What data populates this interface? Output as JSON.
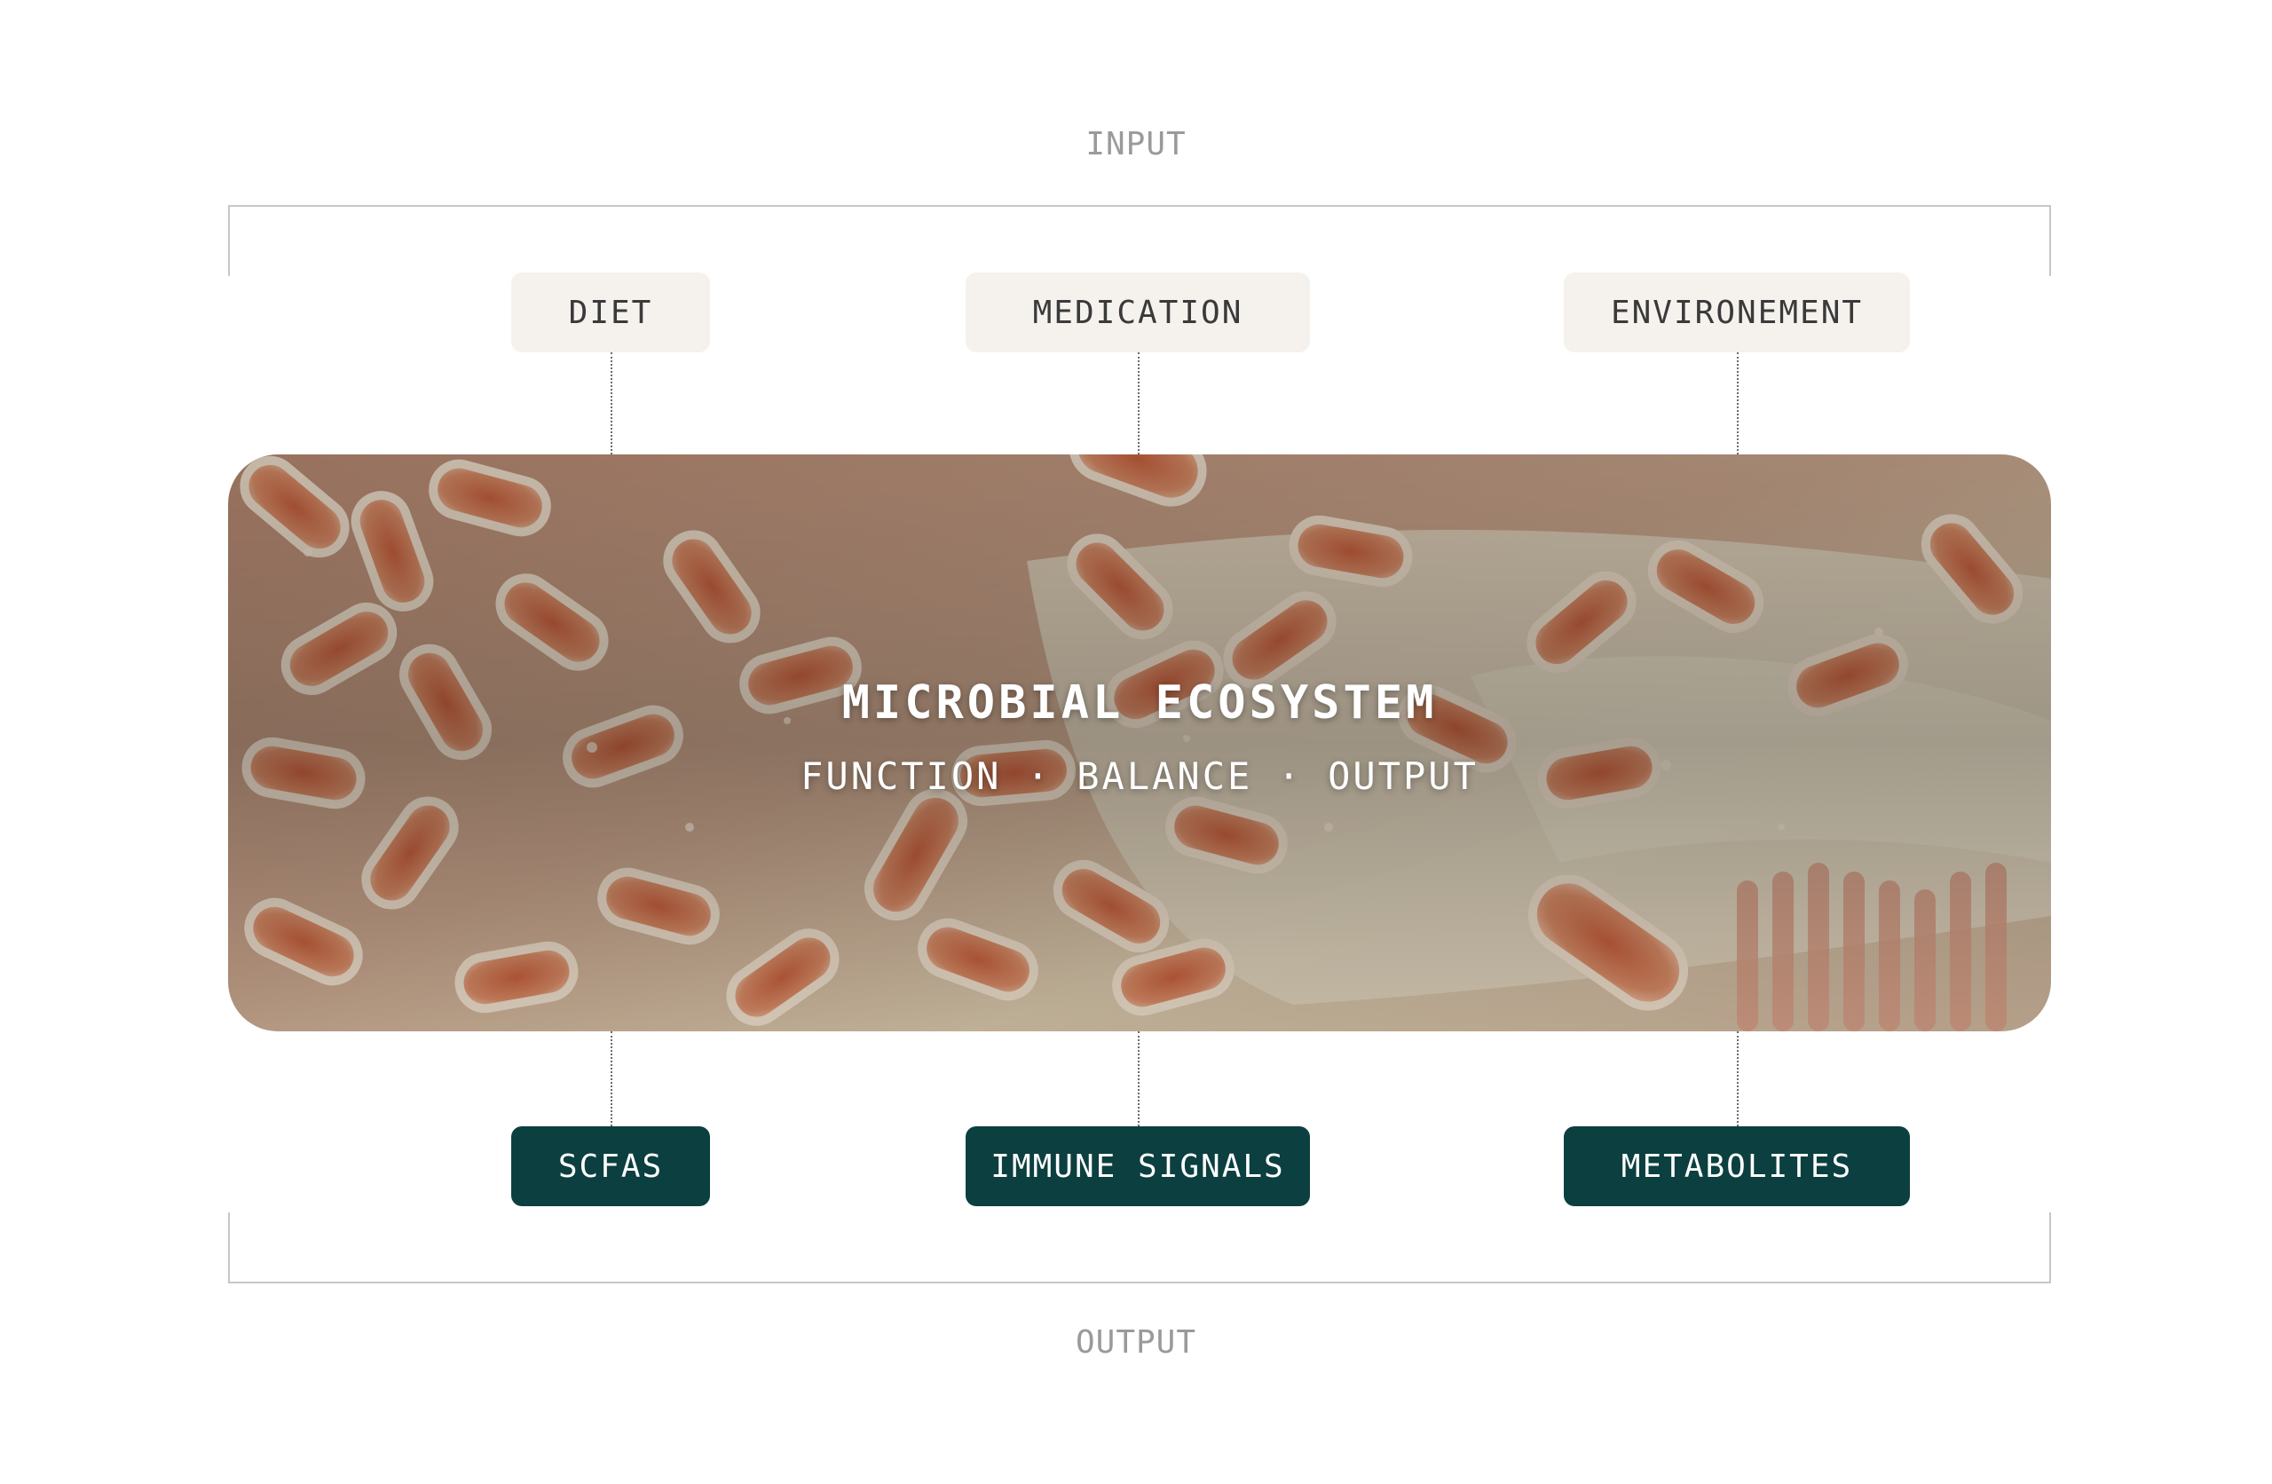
{
  "diagram": {
    "input_label": "INPUT",
    "output_label": "OUTPUT",
    "inputs": [
      "DIET",
      "MEDICATION",
      "ENVIRONEMENT"
    ],
    "outputs": [
      "SCFAS",
      "IMMUNE SIGNALS",
      "METABOLITES"
    ],
    "center": {
      "title": "MICROBIAL ECOSYSTEM",
      "subtitle": "FUNCTION · BALANCE · OUTPUT"
    }
  },
  "colors": {
    "input_chip_bg": "#f5f2ee",
    "output_chip_bg": "#0c3f3f",
    "section_label": "#9a9a9a",
    "bacteria": "#d88a64",
    "tissue": "#d9ccb3"
  }
}
